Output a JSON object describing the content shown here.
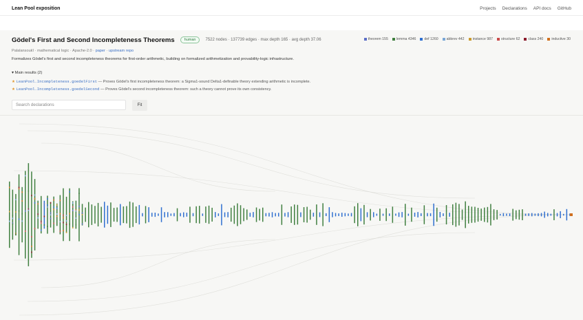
{
  "app": {
    "brand": "Lean Pool exposition"
  },
  "nav": [
    "Projects",
    "Declarations",
    "API docs",
    "GitHub"
  ],
  "header": {
    "title": "Gödel's First and Second Incompleteness Theorems",
    "badge": "human",
    "stats": "7522 nodes · 137739 edges · max depth 165 · avg depth 37.06",
    "meta_prefix": "Palalansoukî · mathematical logic · Apache-2.0 · ",
    "paper_link": "paper",
    "meta_sep": " · ",
    "repo_link": "upstream repo",
    "description": "Formalizes Gödel's first and second incompleteness theorems for first-order arithmetic, building on formalized arithmetization and provability-logic infrastructure.",
    "main_results_label": "▾ Main results (2)",
    "results": [
      {
        "name": "LeanPool.Incompleteness.goedelFirst",
        "text": " — Proves Gödel's first incompleteness theorem: a Sigma1-sound Delta1-definable theory extending arithmetic is incomplete."
      },
      {
        "name": "LeanPool.Incompleteness.goedelSecond",
        "text": " — Proves Gödel's second incompleteness theorem: such a theory cannot prove its own consistency."
      }
    ]
  },
  "legend": [
    {
      "label": "theorem 155",
      "color": "#5b6ec7"
    },
    {
      "label": "lemma 4346",
      "color": "#3f7f3f"
    },
    {
      "label": "def 1260",
      "color": "#2f6fd0"
    },
    {
      "label": "abbrev 442",
      "color": "#7aa7d6"
    },
    {
      "label": "instance 987",
      "color": "#c99a2e"
    },
    {
      "label": "structure 62",
      "color": "#c94a4a"
    },
    {
      "label": "class 240",
      "color": "#8a1a2a"
    },
    {
      "label": "inductive 30",
      "color": "#d0701e"
    }
  ],
  "search": {
    "placeholder": "Search declarations",
    "value": ""
  },
  "fit_label": "Fit",
  "graph": {
    "accent_lemma": "#3f7f3f",
    "accent_def": "#2f6fd0",
    "edge_color": "#d9d9d4"
  }
}
